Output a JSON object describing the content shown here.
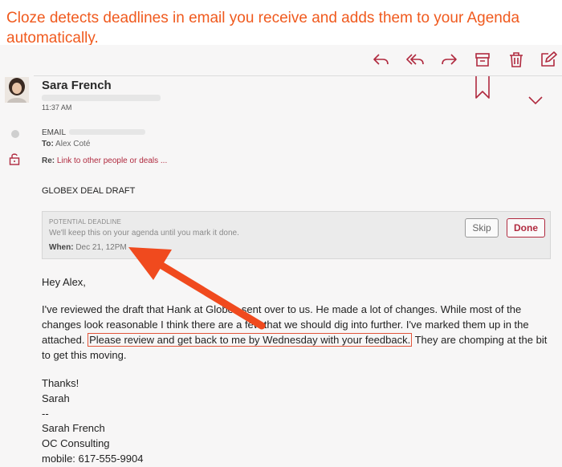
{
  "caption": "Cloze detects deadlines in email you receive and adds them to your Agenda automatically.",
  "toolbar": {
    "icons": [
      "reply-icon",
      "reply-all-icon",
      "forward-icon",
      "archive-icon",
      "trash-icon",
      "edit-icon"
    ]
  },
  "message": {
    "sender_name": "Sara French",
    "time": "11:37 AM",
    "email_label": "EMAIL",
    "to_label": "To:",
    "to_value": "Alex Coté",
    "re_label": "Re:",
    "re_link": "Link to other people or deals ...",
    "subject": "GLOBEX DEAL DRAFT"
  },
  "deadline": {
    "title": "POTENTIAL DEADLINE",
    "note": "We'll keep this on your agenda until you mark it done.",
    "when_label": "When:",
    "when_value": "Dec 21, 12PM",
    "skip_label": "Skip",
    "done_label": "Done"
  },
  "body": {
    "greeting": "Hey Alex,",
    "p1_before": "I've reviewed the draft that Hank at Globex sent over to us. He made a lot of changes. While most of the changes look reasonable I think there are a few that we should dig into further. I've marked them up in the attached. ",
    "p1_highlight": "Please review and get back to me by Wednesday with your feedback.",
    "p1_after": " They are chomping at the bit to get this moving.",
    "thanks": "Thanks!",
    "sign": "Sarah",
    "dashes": "--",
    "sig_name": "Sarah French",
    "sig_company": "OC Consulting",
    "sig_mobile": "mobile: 617-555-9904"
  },
  "colors": {
    "accent": "#b02a3f",
    "annotation": "#f05a1e"
  }
}
